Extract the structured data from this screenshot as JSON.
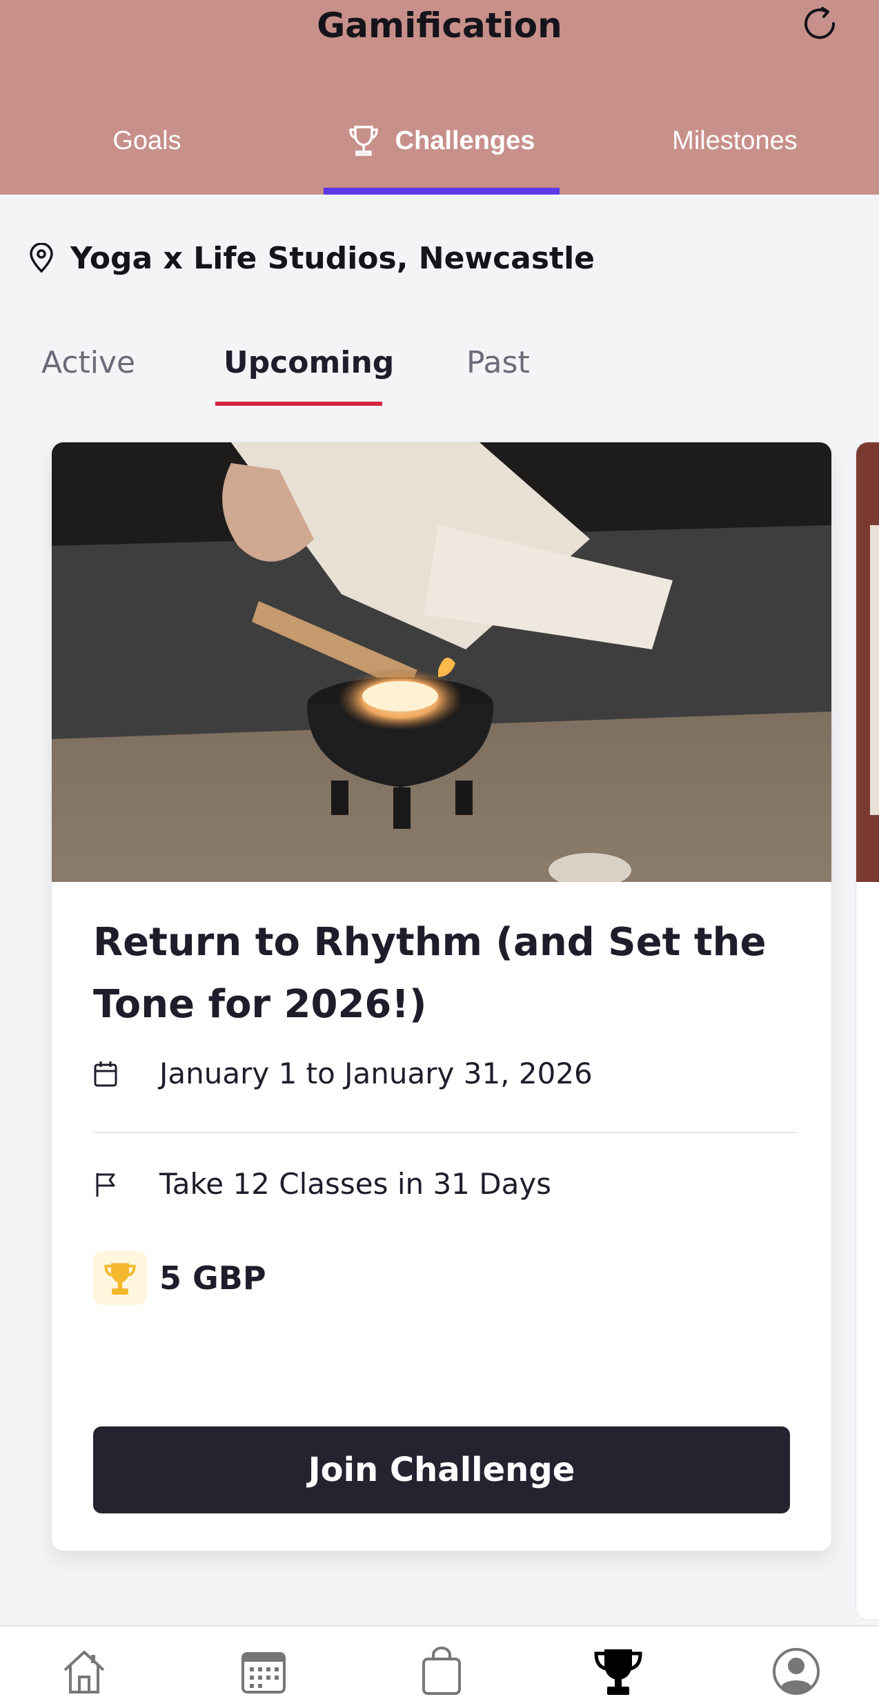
{
  "header": {
    "title": "Gamification",
    "refresh_icon": "refresh-icon"
  },
  "top_tabs": [
    {
      "label": "Goals",
      "selected": false
    },
    {
      "label": "Challenges",
      "selected": true,
      "icon": "trophy-icon"
    },
    {
      "label": "Milestones",
      "selected": false
    }
  ],
  "location": {
    "icon": "location-pin-icon",
    "name": "Yoga x Life Studios, Newcastle"
  },
  "sub_tabs": [
    {
      "label": "Active",
      "selected": false
    },
    {
      "label": "Upcoming",
      "selected": true
    },
    {
      "label": "Past",
      "selected": false
    }
  ],
  "challenge": {
    "image_description": "hand lighting palo santo stick over candle",
    "title": "Return to Rhythm (and Set the Tone for 2026!)",
    "dates": "January 1 to January 31, 2026",
    "goal": "Take 12 Classes in 31 Days",
    "reward": "5 GBP",
    "join_label": "Join Challenge"
  },
  "bottom_nav": [
    {
      "icon": "home-icon",
      "selected": false
    },
    {
      "icon": "calendar-icon",
      "selected": false
    },
    {
      "icon": "shopping-bag-icon",
      "selected": false
    },
    {
      "icon": "trophy-icon",
      "selected": true
    },
    {
      "icon": "profile-icon",
      "selected": false
    }
  ],
  "colors": {
    "header_bg": "#c8908a",
    "tab_indicator": "#5b3be8",
    "sub_tab_indicator": "#d3263f",
    "button_bg": "#25232f"
  }
}
